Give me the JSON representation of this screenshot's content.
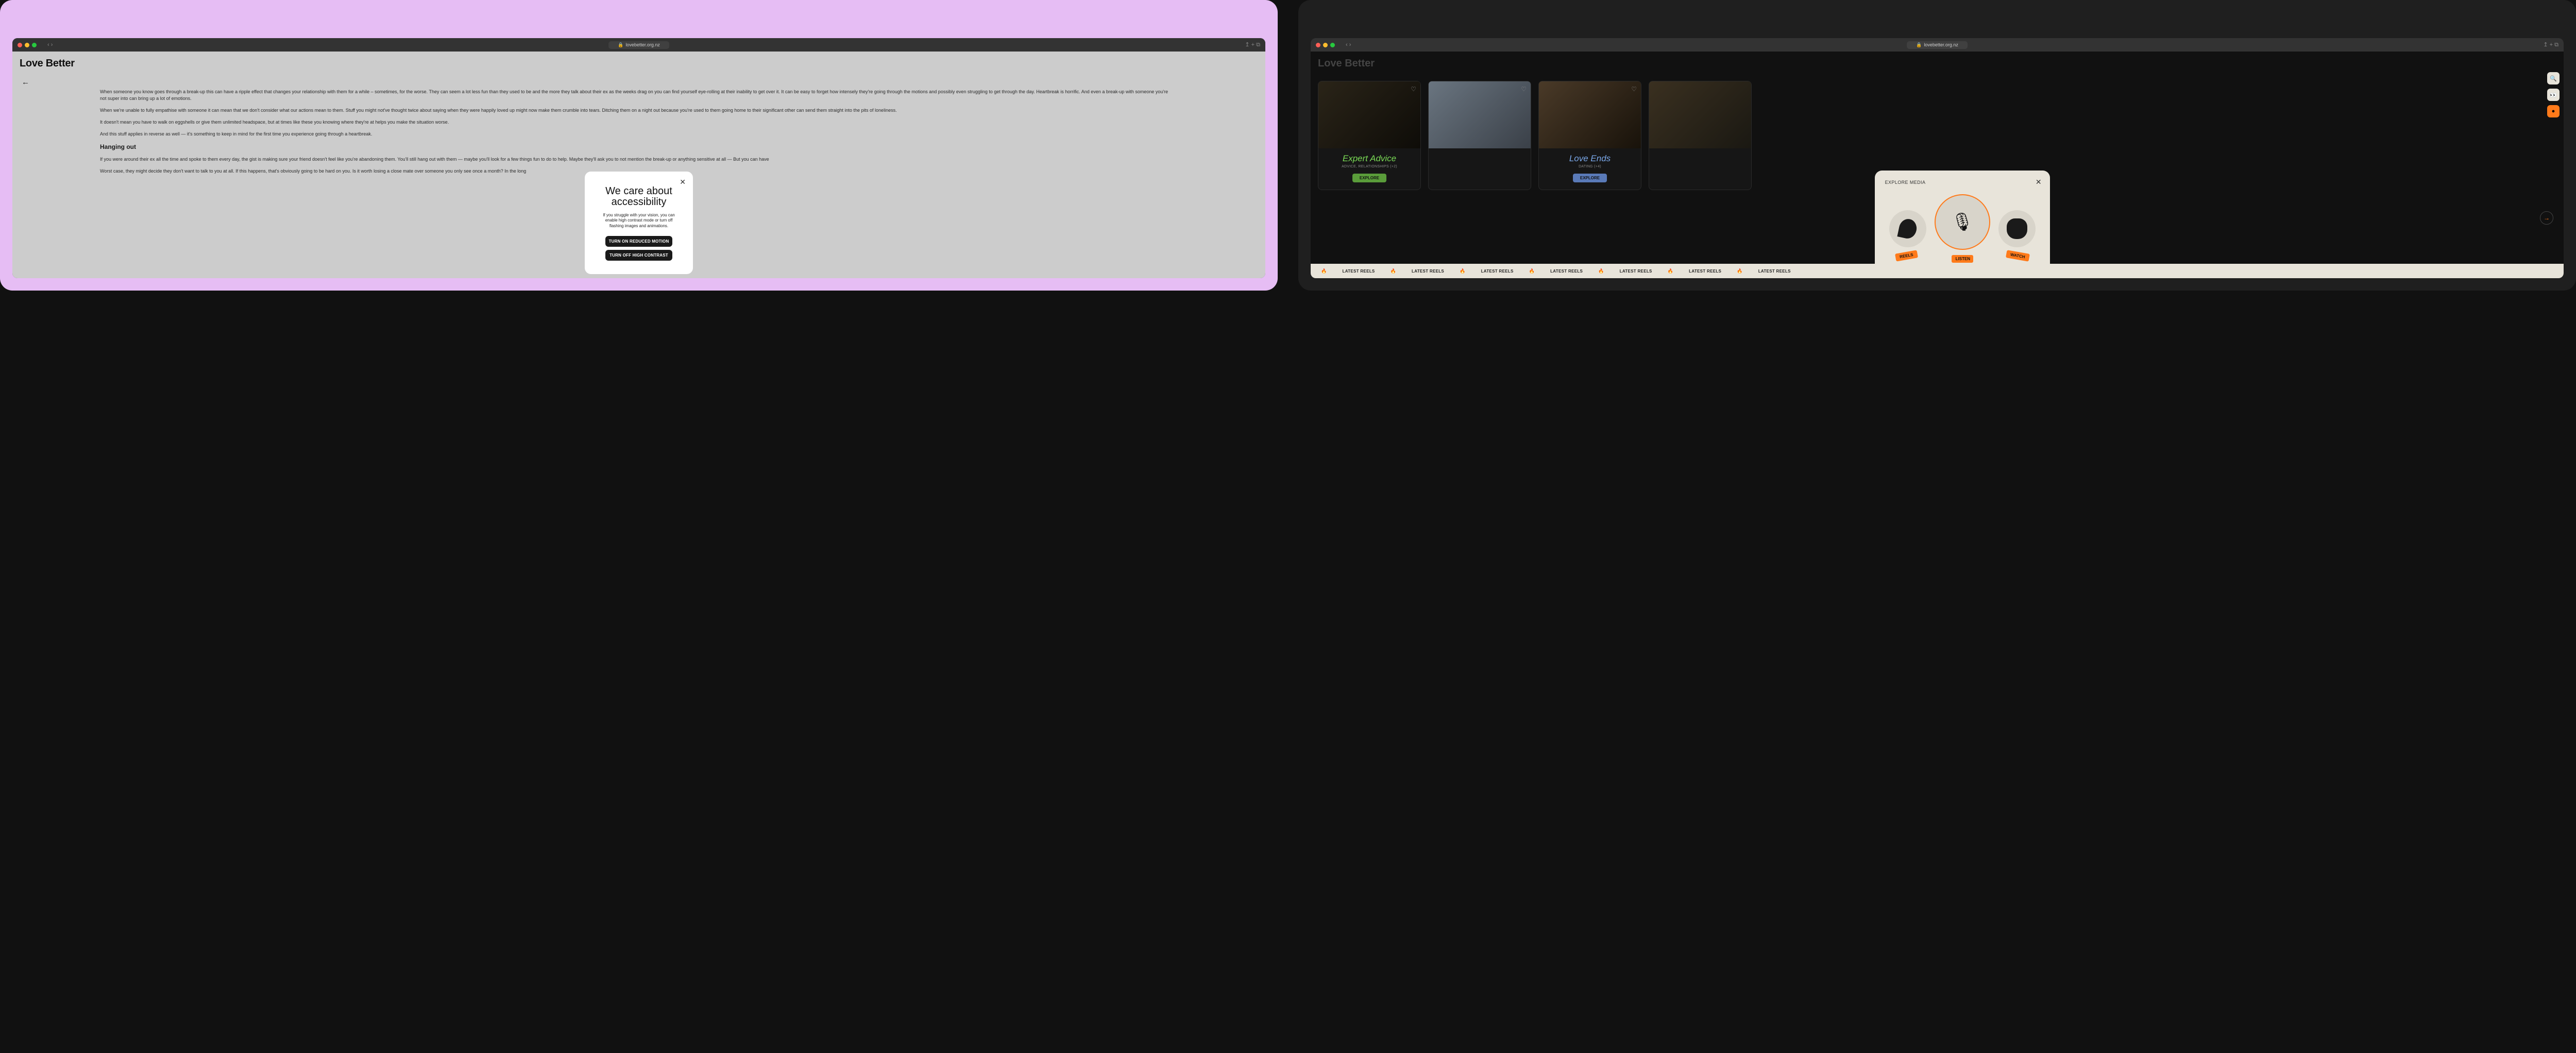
{
  "browser": {
    "url": "lovebetter.org.nz"
  },
  "logo": "Love Better",
  "article": {
    "p1": "When someone you know goes through a break-up this can have a ripple effect that changes your relationship with them for a while – sometimes, for the worse. They can seem a lot less fun than they used to be and the more they talk about their ex as the weeks drag on you can find yourself eye-rolling at their inability to get over it. It can be easy to forget how intensely they're going through the motions and possibly even struggling to get through the day. Heartbreak is horrific. And even a break-up with someone you're not super into can bring up a lot of emotions.",
    "p2": "When we're unable to fully empathise with someone it can mean that we don't consider what our actions mean to them. Stuff you might not've thought twice about saying when they were happily loved up might now make them crumble into tears. Ditching them on a night out because you're used to them going home to their significant other can send them straight into the pits of loneliness.",
    "p3": "It doesn't mean you have to walk on eggshells or give them unlimited headspace, but at times like these you knowing where they're at helps you make the situation worse.",
    "p4": "And this stuff applies in reverse as well — it's something to keep in mind for the first time you experience going through a heartbreak.",
    "h": "Hanging out",
    "p5": "If you were around their ex all the time and spoke to them every day, the gist is making sure your friend doesn't feel like you're abandoning them. You'll still hang out with them — maybe you'll look for a few things fun to do to help. Maybe they'll ask you to not mention the break-up or anything sensitive at all — But you can have",
    "p6": "Worst case, they might decide they don't want to talk to you at all. If this happens, that's obviously going to be hard on you. Is it worth losing a close mate over someone you only see once a month? In the long"
  },
  "a11y_modal": {
    "title": "We care about accessibility",
    "body": "If you struggle with your vision, you can enable high contrast mode or turn off flashing images and animations.",
    "btn1": "TURN ON REDUCED MOTION",
    "btn2": "TURN OFF HIGH CONTRAST"
  },
  "cards": [
    {
      "title": "Expert Advice",
      "tags": "ADVICE, RELATIONSHIPS (+2)",
      "cta": "EXPLORE",
      "color": "green"
    },
    {
      "title": "",
      "tags": "",
      "cta": "",
      "color": ""
    },
    {
      "title": "Love Ends",
      "tags": "DATING (+4)",
      "cta": "EXPLORE",
      "color": "blue"
    }
  ],
  "explore_modal": {
    "title": "EXPLORE MEDIA",
    "listen": "LISTEN",
    "reels": "REELS",
    "watch": "WATCH"
  },
  "ticker": "LATEST REELS"
}
